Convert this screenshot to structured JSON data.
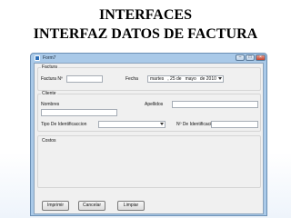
{
  "slide": {
    "title_line1": "INTERFACES",
    "title_line2": "INTERFAZ DATOS DE FACTURA"
  },
  "window": {
    "title": "Form7",
    "controls": {
      "minimize": "–",
      "maximize": "□",
      "close": "×"
    }
  },
  "factura": {
    "legend": "Factura",
    "numero_label": "Factura Nº",
    "numero_value": "",
    "fecha_label": "Fecha",
    "fecha": {
      "weekday": "martes",
      "day": ", 25 de",
      "month": "mayo",
      "year": "de 2010"
    }
  },
  "cliente": {
    "legend": "Cliente",
    "nombres_label": "Nombres",
    "apellidos_label": "Apellidos",
    "tipo_id_label": "Tipo De Identificaccion",
    "num_id_label": "Nº De Identificacion"
  },
  "costos": {
    "legend": "Costos"
  },
  "buttons": {
    "imprimir": "Imprimir",
    "cancelar": "Cancelar",
    "limpiar": "Limpiar"
  },
  "colors": {
    "window_frame": "#a9c9e8",
    "client_bg": "#f0f0f0",
    "close_button": "#c4442e"
  }
}
